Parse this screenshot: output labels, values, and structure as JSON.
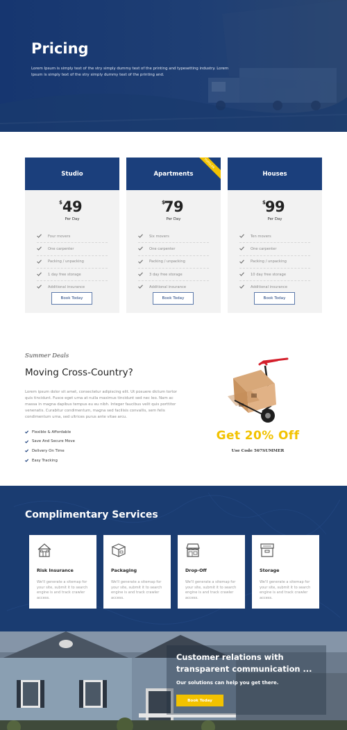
{
  "hero": {
    "title": "Pricing",
    "description": "Lorem Ipsum is simply text of the stry simply dummy text of the printing and typesetting industry. Lorem Ipsum is simply text of the stry simply dummy text of the printing and."
  },
  "pricing": {
    "currency": "$",
    "per_label": "Per Day",
    "book_label": "Book Today",
    "plans": [
      {
        "name": "Studio",
        "price": "49",
        "featured": false,
        "features": [
          "Four movers",
          "One carpenter",
          "Packing / unpacking",
          "1 day free storage",
          "Additional insurance"
        ]
      },
      {
        "name": "Apartments",
        "price": "79",
        "featured": true,
        "ribbon": "POPULAR",
        "features": [
          "Six movers",
          "One carpenter",
          "Packing / unpacking",
          "3 day free storage",
          "Additional insurance"
        ]
      },
      {
        "name": "Houses",
        "price": "99",
        "featured": false,
        "features": [
          "Ten movers",
          "One carpenter",
          "Packing / unpacking",
          "10 day free storage",
          "Additional insurance"
        ]
      }
    ]
  },
  "deals": {
    "kicker": "Summer Deals",
    "title": "Moving Cross-Country?",
    "text": "Lorem ipsum dolor sit amet, consectetur adipiscing elit. Ut posuere dictum tortor quis tincidunt. Fusce eget urna at nulla maximus tincidunt sed nec leo. Nam ac massa in magna dapibus tempus eu eu nibh. Integer faucibus velit quis porttitor venenatis. Curabitur condimentum, magna sed facilisis convallis, sem felis condimentum urna, sed ultrices purus ante vitae arcu.",
    "bullets": [
      "Flexible & Affordable",
      "Save And Secure Move",
      "Delivery On Time",
      "Easy Tracking"
    ],
    "offer": "Get 20% Off",
    "code": "Use Code 567SUMMER"
  },
  "services": {
    "title": "Complimentary Services",
    "items": [
      {
        "title": "Risk Insurance",
        "icon": "house-icon",
        "text": "We'll generate a sitemap for your site, submit it to search engine is and track crawler access."
      },
      {
        "title": "Packaging",
        "icon": "box-icon",
        "text": "We'll generate a sitemap for your site, submit it to search engine is and track crawler access."
      },
      {
        "title": "Drop-Off",
        "icon": "store-icon",
        "text": "We'll generate a sitemap for your site, submit it to search engine is and track crawler access."
      },
      {
        "title": "Storage",
        "icon": "storage-box-icon",
        "text": "We'll generate a sitemap for your site, submit it to search engine is and track crawler access."
      }
    ]
  },
  "customer": {
    "title": "Customer relations with transparent communication ...",
    "subtitle": "Our solutions can help you get there.",
    "button": "Book Today"
  },
  "colors": {
    "navy": "#1b3f7c",
    "accent": "#f2c200"
  }
}
